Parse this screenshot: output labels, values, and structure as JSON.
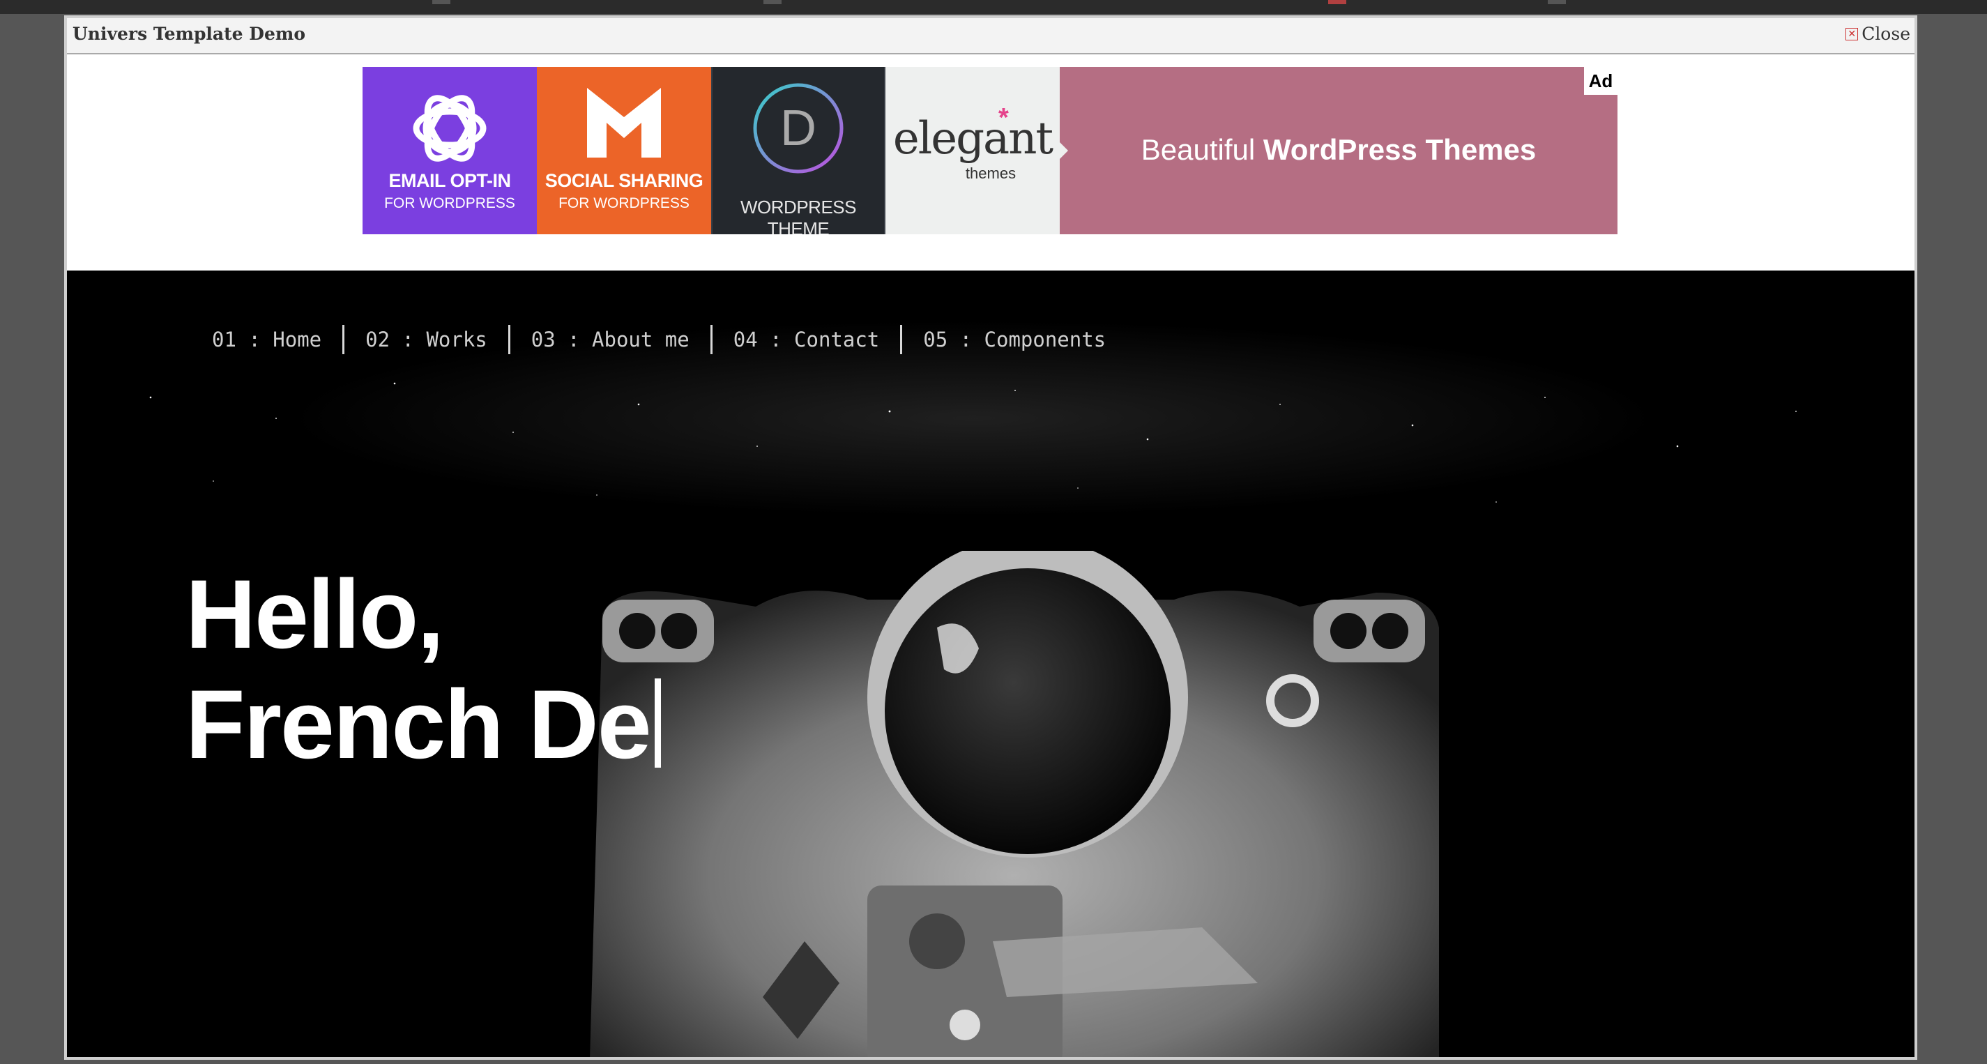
{
  "modal": {
    "title": "Univers Template Demo",
    "close_label": "Close"
  },
  "ad": {
    "badge": "Ad",
    "tiles": [
      {
        "title": "EMAIL OPT-IN",
        "subtitle": "FOR WORDPRESS",
        "color": "#7b3fe0",
        "icon": "bloom-flower-icon"
      },
      {
        "title": "SOCIAL SHARING",
        "subtitle": "FOR WORDPRESS",
        "color": "#ec6428",
        "icon": "monarch-m-icon"
      },
      {
        "title": "WORDPRESS THEME",
        "color": "#24282d",
        "icon": "divi-d-icon"
      },
      {
        "title": "elegant",
        "subtitle": "themes",
        "color": "#eef0ef",
        "icon": "elegant-themes-logo"
      }
    ],
    "headline_light": "Beautiful ",
    "headline_bold": "WordPress Themes",
    "headline_color": "#b56e83"
  },
  "nav": {
    "items": [
      {
        "label": "01 : Home"
      },
      {
        "label": "02 : Works"
      },
      {
        "label": "03 : About me"
      },
      {
        "label": "04 : Contact"
      },
      {
        "label": "05 : Components"
      }
    ]
  },
  "hero": {
    "line1": "Hello,",
    "line2": "French De",
    "image": "astronaut-photo"
  }
}
